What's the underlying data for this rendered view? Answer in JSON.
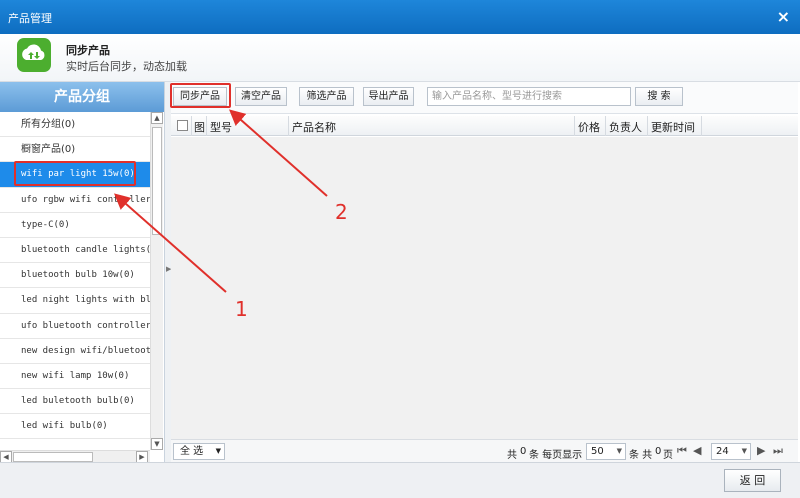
{
  "window": {
    "title": "产品管理",
    "close_glyph": "×"
  },
  "header": {
    "title": "同步产品",
    "subtitle": "实时后台同步，动态加载",
    "icon": "cloud-sync-icon",
    "icon_color": "#4cae2f"
  },
  "left_panel": {
    "title": "产品分组",
    "groups": [
      {
        "label": "所有分组(0)"
      },
      {
        "label": "橱窗产品(0)"
      },
      {
        "label": "wifi par light 15w(0)"
      },
      {
        "label": "ufo rgbw wifi controller(0"
      },
      {
        "label": "type-C(0)"
      },
      {
        "label": "bluetooth candle lights(0)"
      },
      {
        "label": "bluetooth bulb 10w(0)"
      },
      {
        "label": "led night lights with blue"
      },
      {
        "label": "ufo bluetooth controller r"
      },
      {
        "label": "new design wifi/bluetooth"
      },
      {
        "label": "new wifi lamp 10w(0)"
      },
      {
        "label": "led buletooth bulb(0)"
      },
      {
        "label": "led wifi bulb(0)"
      }
    ],
    "selected_index": 2
  },
  "toolbar": {
    "sync": "同步产品",
    "clear": "清空产品",
    "filter": "筛选产品",
    "export": "导出产品",
    "search_placeholder": "输入产品名称、型号进行搜索",
    "search_button": "搜 索"
  },
  "table": {
    "columns": {
      "image": "图",
      "model": "型号",
      "name": "产品名称",
      "price": "价格",
      "owner": "负责人",
      "updated": "更新时间"
    }
  },
  "footer": {
    "select_all": "全 选",
    "total_prefix": "共",
    "total_count": "0",
    "total_mid": "条 每页显示",
    "page_size": "50",
    "pages_prefix": "条 共",
    "page_count": "0",
    "pages_suffix": "页",
    "current_page": "24"
  },
  "bottom": {
    "back": "返 回"
  },
  "annotations": {
    "label_1": "1",
    "label_2": "2",
    "color": "#e0302b"
  },
  "colors": {
    "title_bar": "#1e86da",
    "selected_row": "#1e8bea"
  }
}
